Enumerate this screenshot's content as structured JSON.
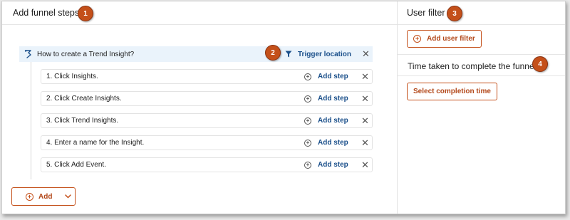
{
  "left_panel": {
    "title": "Add funnel steps",
    "badge": "1",
    "group": {
      "label": "How to create a Trend Insight?",
      "trigger_label": "Trigger location",
      "badge": "2",
      "remove_icon": "close-icon"
    },
    "steps": [
      {
        "label": "1. Click Insights.",
        "add_label": "Add step"
      },
      {
        "label": "2. Click Create Insights.",
        "add_label": "Add step"
      },
      {
        "label": "3. Click Trend Insights.",
        "add_label": "Add step"
      },
      {
        "label": "4. Enter a name for the Insight.",
        "add_label": "Add step"
      },
      {
        "label": "5. Click Add Event.",
        "add_label": "Add step"
      }
    ],
    "add_button": {
      "label": "Add"
    }
  },
  "right_panel": {
    "user_filter": {
      "title": "User filter",
      "badge": "3",
      "button_label": "Add user filter"
    },
    "time_taken": {
      "title": "Time taken to complete the funnel",
      "badge": "4",
      "button_label": "Select completion time"
    }
  },
  "colors": {
    "accent_orange": "#c4501a",
    "link_blue": "#1a4f8a",
    "group_bg": "#eaf3fb"
  }
}
